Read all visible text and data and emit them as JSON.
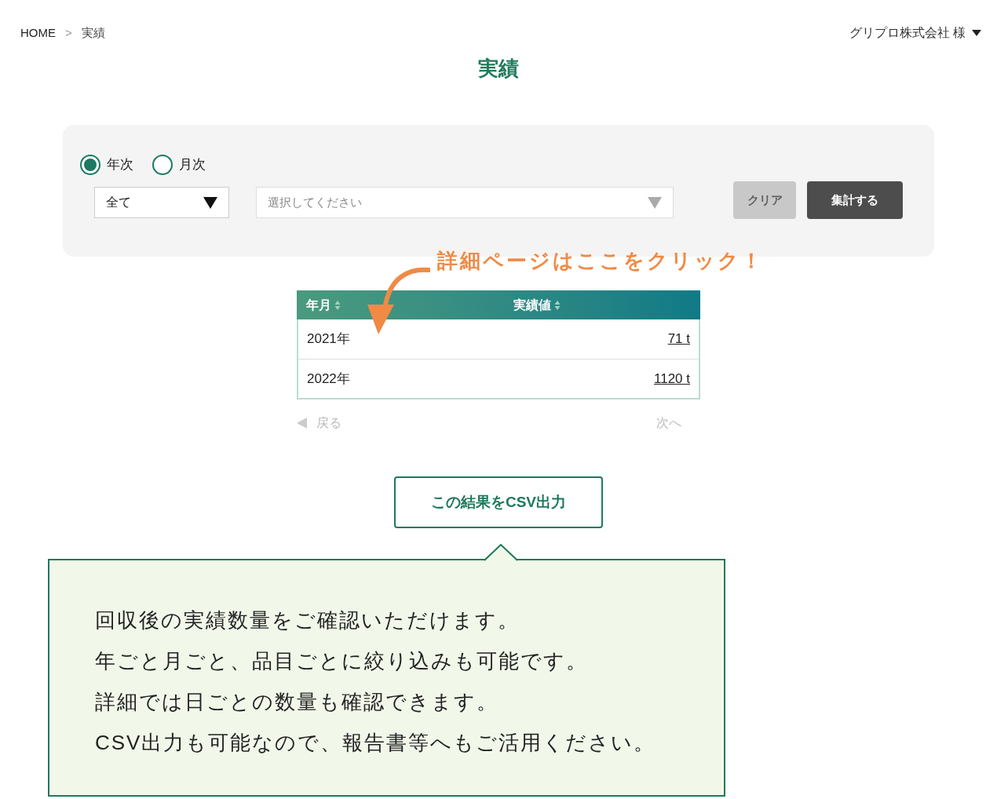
{
  "breadcrumb": {
    "items": [
      "HOME",
      "実績"
    ],
    "separator": ">"
  },
  "user_menu": {
    "label": "グリプロ株式会社 様"
  },
  "page_title": "実績",
  "filter": {
    "period_options": [
      {
        "label": "年次",
        "selected": true
      },
      {
        "label": "月次",
        "selected": false
      }
    ],
    "category_select": {
      "value": "全て"
    },
    "item_select": {
      "placeholder": "選択してください"
    },
    "buttons": [
      {
        "label": "クリア",
        "kind": "clear",
        "disabled": true
      },
      {
        "label": "集計する",
        "kind": "submit",
        "disabled": false
      }
    ]
  },
  "annotation": "詳細ページはここをクリック！",
  "table": {
    "columns": [
      "年月",
      "実績値"
    ],
    "rows": [
      {
        "period": "2021年",
        "value": "71 t"
      },
      {
        "period": "2022年",
        "value": "1120 t"
      }
    ]
  },
  "pager": {
    "prev": {
      "label": "戻る",
      "disabled": true
    },
    "next": {
      "label": "次へ",
      "disabled": true
    }
  },
  "csv_button": "この結果をCSV出力",
  "callout": {
    "lines": [
      "回収後の実績数量をご確認いただけます。",
      "年ごと月ごと、品目ごとに絞り込みも可能です。",
      "詳細では日ごとの数量も確認できます。",
      "CSV出力も可能なので、報告書等へもご活用ください。"
    ]
  }
}
